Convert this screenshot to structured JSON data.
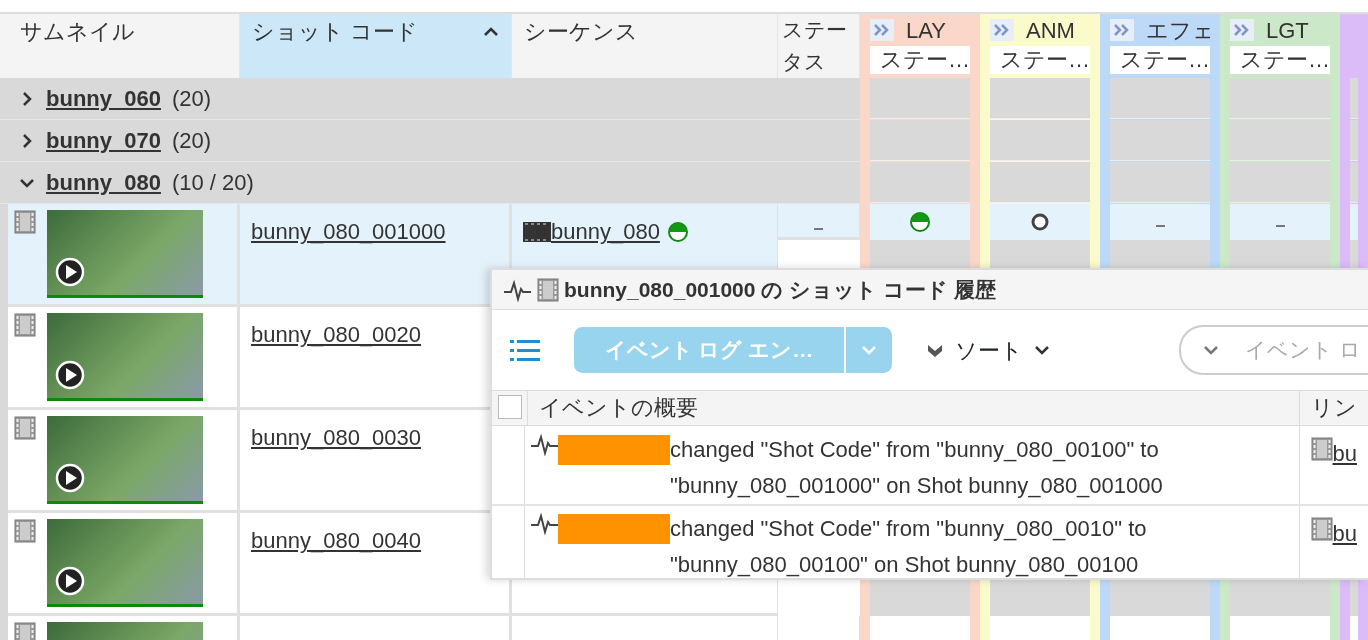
{
  "columns": [
    {
      "label": "サムネイル",
      "sorted": false
    },
    {
      "label": "ショット コード",
      "sorted": true
    },
    {
      "label": "シーケンス",
      "sorted": false
    },
    {
      "label": "ステータス",
      "sorted": false
    }
  ],
  "steps": [
    {
      "label": "LAY",
      "sub": "ステー…",
      "color": "#fad7c8"
    },
    {
      "label": "ANM",
      "sub": "ステー…",
      "color": "#fbfacb"
    },
    {
      "label": "エフェ",
      "sub": "ステー…",
      "color": "#bcdaf8"
    },
    {
      "label": "LGT",
      "sub": "ステー…",
      "color": "#cbe9c9"
    },
    {
      "color": "#dcbcf8"
    }
  ],
  "groups": [
    {
      "name": "bunny_060",
      "count": "(20)",
      "expanded": false
    },
    {
      "name": "bunny_070",
      "count": "(20)",
      "expanded": false
    },
    {
      "name": "bunny_080",
      "count": "(10 / 20)",
      "expanded": true
    }
  ],
  "shots": [
    {
      "code": "bunny_080_001000",
      "selected": true,
      "sequence": "bunny_080",
      "sequence_status": {
        "kind": "half"
      },
      "status": {
        "kind": "none"
      },
      "step_statuses": [
        {
          "kind": "half"
        },
        {
          "kind": "ring"
        },
        {
          "kind": "none"
        },
        {
          "kind": "none"
        }
      ]
    },
    {
      "code": "bunny_080_0020",
      "selected": false
    },
    {
      "code": "bunny_080_0030",
      "selected": false
    },
    {
      "code": "bunny_080_0040",
      "selected": false
    },
    {
      "selected": false
    }
  ],
  "history": {
    "title": "bunny_080_001000 の ショット コード 履歴",
    "primary_button": "イベント ログ エン…",
    "sort": "ソート",
    "search": {
      "placeholder": "イベント ロ"
    },
    "select_all_checked": false,
    "columns": [
      "イベントの概要",
      "リン"
    ],
    "rows": [
      {
        "text": "changed \"Shot Code\" from \"bunny_080_00100\" to \"bunny_080_001000\" on Shot bunny_080_001000",
        "link": "bu"
      },
      {
        "text": "changed \"Shot Code\" from \"bunny_080_0010\" to \"bunny_080_00100\" on Shot bunny_080_00100",
        "link": "bu"
      }
    ]
  }
}
